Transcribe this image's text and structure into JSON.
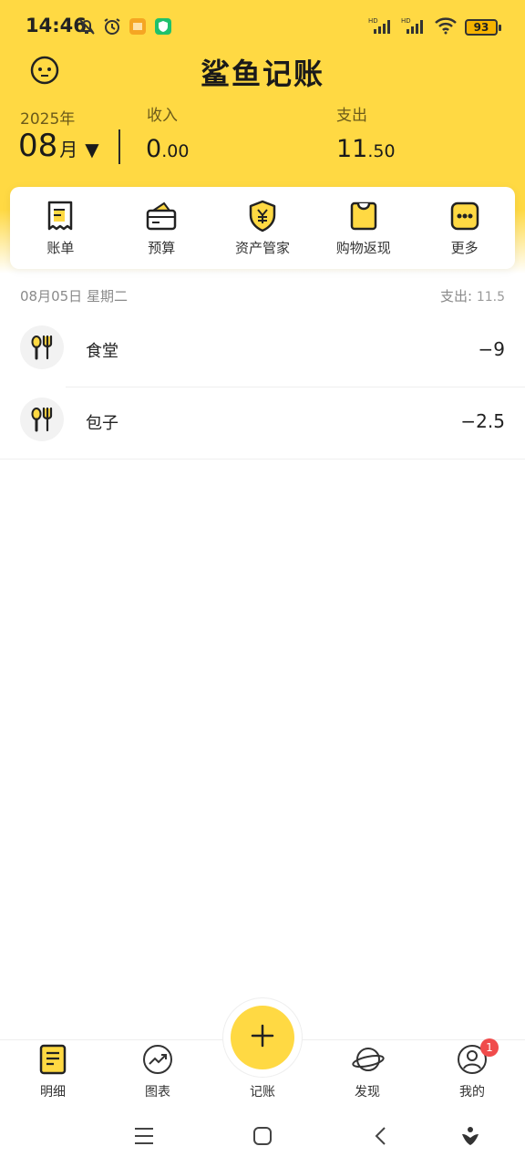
{
  "status_bar": {
    "time": "14:46",
    "battery": "93",
    "icons": [
      "bell-off-icon",
      "alarm-icon",
      "gallery-app-icon",
      "security-app-icon",
      "hd-signal-icon",
      "hd-signal-icon",
      "wifi-icon",
      "battery-icon"
    ]
  },
  "header": {
    "title": "鲨鱼记账",
    "year": "2025年",
    "month": "08",
    "month_unit": "月",
    "month_caret": "▼",
    "income_label": "收入",
    "income_int": "0",
    "income_dec": ".00",
    "expense_label": "支出",
    "expense_int": "11",
    "expense_dec": ".50"
  },
  "quick_menu": [
    {
      "label": "账单",
      "icon": "bill-icon"
    },
    {
      "label": "预算",
      "icon": "budget-wallet-icon"
    },
    {
      "label": "资产管家",
      "icon": "asset-shield-icon"
    },
    {
      "label": "购物返现",
      "icon": "shopping-bag-icon"
    },
    {
      "label": "更多",
      "icon": "more-dots-icon"
    }
  ],
  "records": {
    "date": "08月05日 星期二",
    "summary_label": "支出:",
    "summary_value": "11.5",
    "items": [
      {
        "name": "食堂",
        "amount": "−9",
        "icon": "food-icon"
      },
      {
        "name": "包子",
        "amount": "−2.5",
        "icon": "food-icon"
      }
    ]
  },
  "tabbar": {
    "tabs": [
      {
        "label": "明细",
        "icon": "detail-list-icon"
      },
      {
        "label": "图表",
        "icon": "chart-trend-icon"
      },
      {
        "label": "记账",
        "icon": "plus-icon"
      },
      {
        "label": "发现",
        "icon": "planet-icon"
      },
      {
        "label": "我的",
        "icon": "profile-icon"
      }
    ],
    "mine_badge": "1"
  },
  "colors": {
    "accent": "#FFD943",
    "badge": "#F04B4B",
    "text": "#222222"
  }
}
